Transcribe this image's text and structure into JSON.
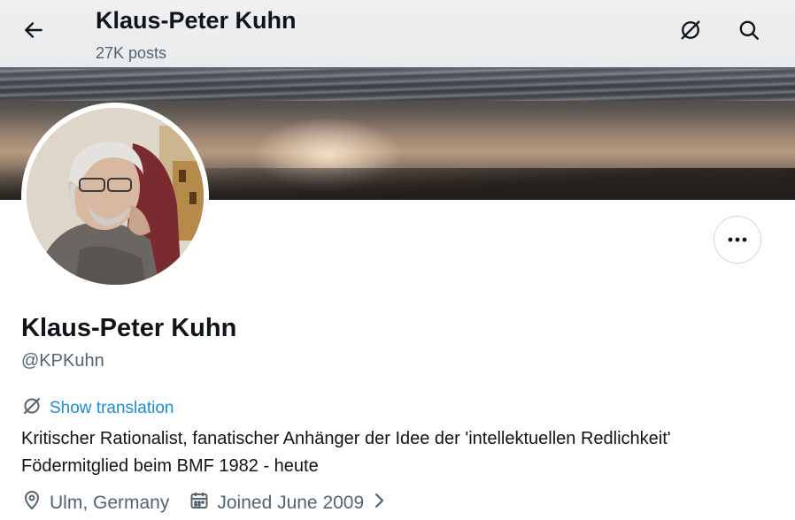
{
  "header": {
    "title": "Klaus-Peter Kuhn",
    "post_count": "27K posts"
  },
  "icons": {
    "back": "arrow-left-icon",
    "translate": "translate-icon",
    "search": "search-icon",
    "more": "more-horizontal-icon",
    "location": "location-pin-icon",
    "calendar": "calendar-icon",
    "chevron": "chevron-right-icon"
  },
  "profile": {
    "display_name": "Klaus-Peter Kuhn",
    "handle": "@KPKuhn",
    "show_translation": "Show translation",
    "bio_lines": [
      "Kritischer Rationalist, fanatischer Anhänger der Idee der 'intellektuellen Redlichkeit'",
      "Födermitglied beim BMF 1982 - heute"
    ],
    "location": "Ulm, Germany",
    "joined": "Joined June 2009"
  },
  "colors": {
    "text_primary": "#0f1419",
    "text_secondary": "#536471",
    "link": "#1a8cd8",
    "border": "#cfd9de"
  }
}
